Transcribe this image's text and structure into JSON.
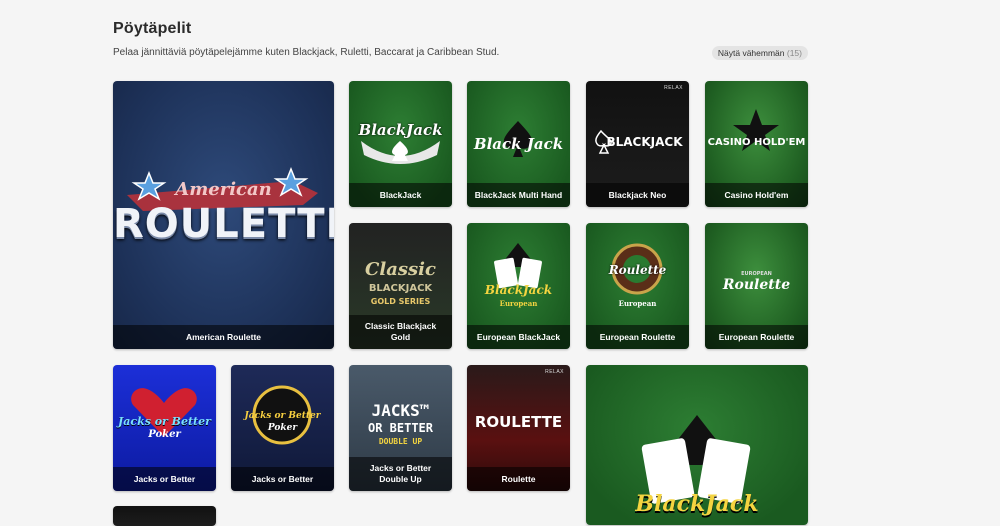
{
  "section": {
    "title": "Pöytäpelit",
    "subtitle": "Pelaa jännittäviä pöytäpelejämme kuten Blackjack, Ruletti, Baccarat ja Caribbean Stud.",
    "show_less_label": "Näytä vähemmän",
    "show_less_count": "(15)"
  },
  "games": [
    {
      "name": "American Roulette",
      "art": {
        "line1": "American",
        "line2": "ROULETTE",
        "tm": "™"
      }
    },
    {
      "name": "BlackJack",
      "art": {
        "text": "BlackJack"
      }
    },
    {
      "name": "BlackJack Multi Hand",
      "art": {
        "text": "Black Jack"
      }
    },
    {
      "name": "Blackjack Neo",
      "art": {
        "text": "BLACKJACK",
        "badge": "RELAX"
      }
    },
    {
      "name": "Casino Hold'em",
      "art": {
        "text": "CASINO HOLD'EM"
      }
    },
    {
      "name": "Classic Blackjack Gold",
      "art": {
        "line1": "Classic",
        "line2": "BLACKJACK",
        "line3": "GOLD SERIES"
      }
    },
    {
      "name": "European BlackJack",
      "art": {
        "line1": "BlackJack",
        "line2": "European"
      }
    },
    {
      "name": "European Roulette",
      "art": {
        "line1": "Roulette",
        "line2": "European"
      }
    },
    {
      "name": "European Roulette",
      "art": {
        "line1": "EUROPEAN",
        "line2": "Roulette"
      }
    },
    {
      "name": "Jacks or Better",
      "art": {
        "line1": "Jacks or Better",
        "line2": "Poker"
      }
    },
    {
      "name": "Jacks or Better",
      "art": {
        "line1": "Jacks or Better",
        "line2": "Poker"
      }
    },
    {
      "name": "Jacks or Better Double Up",
      "art": {
        "line1": "JACKS™",
        "line2": "OR BETTER",
        "line3": "DOUBLE UP"
      }
    },
    {
      "name": "Roulette",
      "art": {
        "text": "ROULETTE",
        "badge": "RELAX"
      }
    },
    {
      "name": "",
      "art": {
        "text": "BlackJack"
      }
    }
  ]
}
